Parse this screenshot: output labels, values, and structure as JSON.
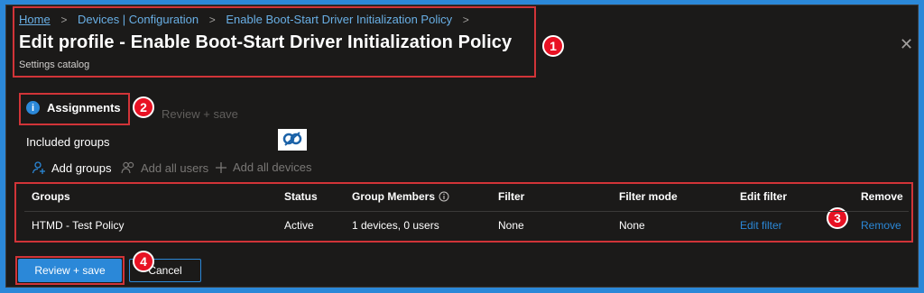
{
  "breadcrumb": {
    "items": [
      "Home",
      "Devices | Configuration",
      "Enable Boot-Start Driver Initialization Policy"
    ],
    "separator": ">"
  },
  "header": {
    "title": "Edit profile - Enable Boot-Start Driver Initialization Policy",
    "subtitle": "Settings catalog",
    "close_glyph": "✕"
  },
  "tabs": [
    {
      "label": "Assignments",
      "active": true,
      "icon": "info-icon"
    },
    {
      "label": "Review + save",
      "active": false
    }
  ],
  "assignments": {
    "section_label": "Included groups",
    "commands": [
      {
        "label": "Add groups",
        "enabled": true,
        "icon": "add-person-icon"
      },
      {
        "label": "Add all users",
        "enabled": false,
        "icon": "people-icon"
      },
      {
        "label": "Add all devices",
        "enabled": false,
        "icon": "plus-icon"
      }
    ],
    "table": {
      "headers": [
        "Groups",
        "Status",
        "Group Members",
        "Filter",
        "Filter mode",
        "Edit filter",
        "Remove"
      ],
      "rows": [
        {
          "group": "HTMD - Test Policy",
          "status": "Active",
          "members": "1 devices, 0 users",
          "filter": "None",
          "filter_mode": "None",
          "edit_filter": "Edit filter",
          "remove": "Remove"
        }
      ]
    }
  },
  "footer": {
    "primary_button": "Review + save",
    "secondary_button": "Cancel"
  },
  "annotations": [
    "1",
    "2",
    "3",
    "4"
  ],
  "colors": {
    "accent": "#2b88d8",
    "callout": "#e81123",
    "highlight_box": "#d13438",
    "background": "#1b1a19"
  }
}
